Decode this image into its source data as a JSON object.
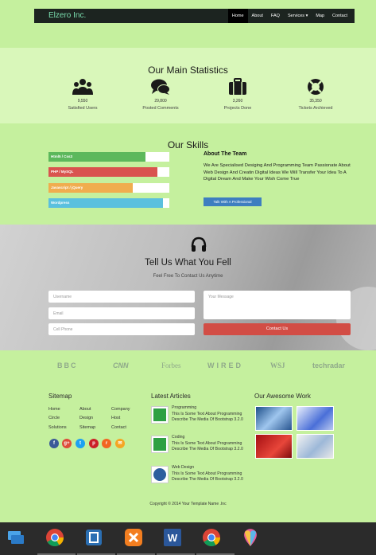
{
  "nav": {
    "brand": "Elzero Inc.",
    "items": [
      "Home",
      "About",
      "FAQ",
      "Services",
      "Map",
      "Contact"
    ],
    "services_arrow": "▾"
  },
  "stats": {
    "title": "Our Main Statistics",
    "items": [
      {
        "value": "9,550",
        "label": "Satisfied Users",
        "icon": "users-icon"
      },
      {
        "value": "29,800",
        "label": "Posted Comments",
        "icon": "comments-icon"
      },
      {
        "value": "3,260",
        "label": "Projects Done",
        "icon": "briefcase-icon"
      },
      {
        "value": "35,350",
        "label": "Tickets Archieved",
        "icon": "lifebuoy-icon"
      }
    ]
  },
  "skills": {
    "title": "Our Skills",
    "bars": [
      {
        "label": "Html5 / Css3",
        "percent": 80,
        "color": "#5cb85c"
      },
      {
        "label": "PHP / MySQL",
        "percent": 90,
        "color": "#d9534f"
      },
      {
        "label": "Javascript / jQuery",
        "percent": 70,
        "color": "#f0ad4e"
      },
      {
        "label": "Wordpress",
        "percent": 95,
        "color": "#5bc0de"
      }
    ],
    "team_title": "About The Team",
    "team_text": "We Are Specialised Desiging And Programming Team Passionate About Web Design And Creatin Digital Ideas We Will Transfer Your Idea To A Digital Dream And Make Your Wish Come True",
    "team_button": "Talk With A Professional"
  },
  "contact": {
    "title": "Tell Us What You Fell",
    "subtitle": "Feel Free To Contact Us Anytime",
    "username_placeholder": "Username",
    "email_placeholder": "Email",
    "phone_placeholder": "Cell Phone",
    "message_placeholder": "Your Message",
    "submit": "Contact Us"
  },
  "brands": [
    "BBC",
    "CNN",
    "Forbes",
    "WIRED",
    "WSJ",
    "techradar"
  ],
  "footer": {
    "sitemap_title": "Sitemap",
    "sitemap": [
      [
        "Home",
        "About",
        "Company"
      ],
      [
        "Circle",
        "Design",
        "Host"
      ],
      [
        "Solutions",
        "Sitemap",
        "Contact"
      ]
    ],
    "social": [
      {
        "name": "facebook-icon",
        "glyph": "f",
        "color": "#3b5998"
      },
      {
        "name": "google-plus-icon",
        "glyph": "g+",
        "color": "#dd4b39"
      },
      {
        "name": "twitter-icon",
        "glyph": "t",
        "color": "#1da1f2"
      },
      {
        "name": "pinterest-icon",
        "glyph": "p",
        "color": "#cb2027"
      },
      {
        "name": "rss-icon",
        "glyph": "r",
        "color": "#f26522"
      },
      {
        "name": "email-icon",
        "glyph": "✉",
        "color": "#f5a623"
      }
    ],
    "articles_title": "Latest Articles",
    "articles": [
      {
        "title": "Programming",
        "text": "This Is Some Text About Programming Describe The Media Of Bootstrap 3.2.0",
        "icon": "calculator-icon"
      },
      {
        "title": "Coding",
        "text": "This Is Some Text About Programming Describe The Media Of Bootstrap 3.2.0",
        "icon": "code-icon"
      },
      {
        "title": "Web Design",
        "text": "This Is Some Text About Programming Describe The Media Of Bootstrap 3.2.0",
        "icon": "globe-icon"
      }
    ],
    "work_title": "Our Awesome Work",
    "copyright": "Copyright © 2014 Your Template Name .Inc"
  },
  "taskbar": {
    "apps": [
      "explorer-icon",
      "chrome-icon",
      "app-icon",
      "xampp-icon",
      "word-icon",
      "chrome-icon",
      "paint-icon"
    ]
  }
}
